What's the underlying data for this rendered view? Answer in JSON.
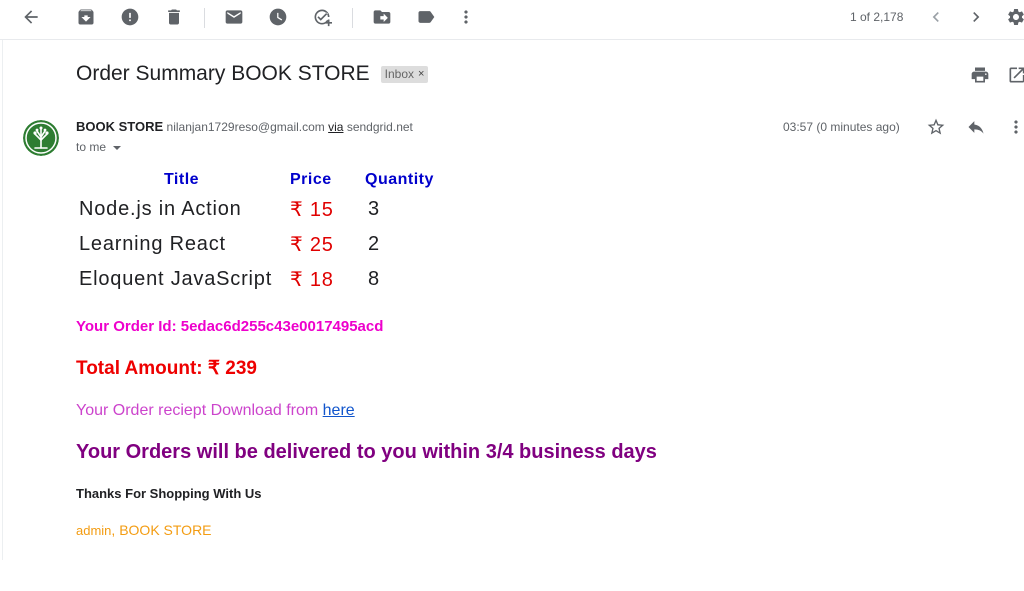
{
  "toolbar": {
    "back_icon": "arrow-back-icon",
    "archive_icon": "archive-icon",
    "spam_icon": "report-spam-icon",
    "delete_icon": "delete-icon",
    "mark_unread_icon": "mark-unread-icon",
    "snooze_icon": "snooze-icon",
    "add_task_icon": "add-task-icon",
    "move_icon": "move-to-icon",
    "label_icon": "label-icon",
    "more_icon": "more-vert-icon",
    "pager_text": "1 of 2,178",
    "newer_icon": "chevron-left-icon",
    "older_icon": "chevron-right-icon",
    "settings_icon": "gear-icon"
  },
  "email": {
    "subject": "Order Summary BOOK STORE",
    "label": "Inbox",
    "label_close": "×",
    "sender_name": "BOOK STORE",
    "sender_email": "nilanjan1729reso@gmail.com",
    "via_label": "via",
    "via_domain": "sendgrid.net",
    "to_text": "to me",
    "time": "03:57 (0 minutes ago)"
  },
  "order": {
    "headers": [
      "Title",
      "Price",
      "Quantity"
    ],
    "currency": "₹",
    "items": [
      {
        "title": "Node.js in Action",
        "price": "₹ 15",
        "quantity": "3"
      },
      {
        "title": "Learning React",
        "price": "₹ 25",
        "quantity": "2"
      },
      {
        "title": "Eloquent JavaScript",
        "price": "₹ 18",
        "quantity": "8"
      }
    ],
    "order_id_text": "Your Order Id: 5edac6d255c43e0017495acd",
    "total_text": "Total Amount: ₹ 239",
    "receipt_text": "Your Order reciept Download from ",
    "receipt_link": "here",
    "delivery_text": "Your Orders will be delivered to you within 3/4 business days",
    "thanks_text": "Thanks For Shopping With Us",
    "signature_admin": "admin",
    "signature_sep": ", ",
    "signature_store": "BOOK STORE"
  },
  "colors": {
    "header_blue": "#0000cc",
    "price_red": "#e00000",
    "order_id_magenta": "#ee00cc",
    "total_red": "#ee0000",
    "delivery_purple": "#800080",
    "signature_orange": "#f39c12",
    "avatar_green": "#2e7d32"
  }
}
